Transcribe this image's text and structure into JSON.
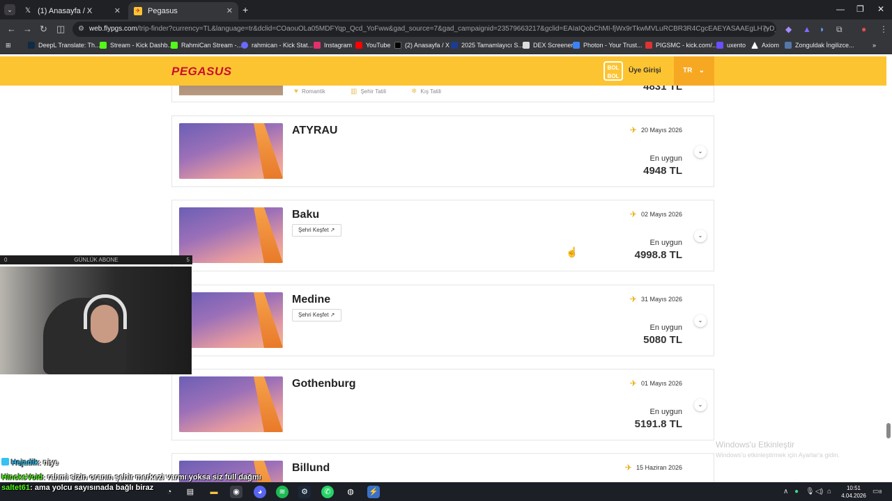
{
  "browser": {
    "tabs": [
      {
        "title": "(1) Anasayfa / X",
        "icon": "x-logo-icon"
      },
      {
        "title": "Pegasus",
        "icon": "pegasus-icon"
      }
    ],
    "url_domain": "web.flypgs.com",
    "url_path": "/trip-finder?currency=TL&language=tr&dclid=COaouOLa05MDFYqp_Qcd_YoFww&gad_source=7&gad_campaignid=23579663217&gclid=EAIaIQobChMI-fjWx9rTkwMVLuRCBR3R4CgcEAEYASAAEgLH7vD_BwE",
    "bookmarks": [
      {
        "label": "DeepL Translate: Th...",
        "color": "#0f2b46"
      },
      {
        "label": "Stream - Kick Dashb...",
        "color": "#53fc18"
      },
      {
        "label": "RahmiCan Stream -...",
        "color": "#53fc18"
      },
      {
        "label": "rahmican - Kick Stat...",
        "color": "#6a6aff"
      },
      {
        "label": "Instagram",
        "color": "#e1306c"
      },
      {
        "label": "YouTube",
        "color": "#ff0000"
      },
      {
        "label": "(2) Anasayfa / X",
        "color": "#000000"
      },
      {
        "label": "2025 Tamamlayıcı S...",
        "color": "#1a3d8f"
      },
      {
        "label": "DEX Screener",
        "color": "#dddddd"
      },
      {
        "label": "Photon - Your Trust...",
        "color": "#3b82f6"
      },
      {
        "label": "PIGSMC - kick.com/...",
        "color": "#d33"
      },
      {
        "label": "uxento",
        "color": "#6b4eff"
      },
      {
        "label": "Axiom",
        "color": "#ffffff"
      },
      {
        "label": "Zonguldak İngilizce...",
        "color": "#5577aa"
      }
    ]
  },
  "header": {
    "logo": "PEGASUS",
    "bolbol": "BOL BOL",
    "login": "Üye Girişi",
    "language": "TR"
  },
  "top_card": {
    "tags": [
      "Romantik",
      "Şehir Tatili",
      "Kış Tatili"
    ],
    "price": "4831 TL"
  },
  "destinations": [
    {
      "name": "ATYRAU",
      "date": "20 Mayıs 2026",
      "best_label": "En uygun",
      "price": "4948 TL",
      "explore": ""
    },
    {
      "name": "Baku",
      "date": "02 Mayıs 2026",
      "best_label": "En uygun",
      "price": "4998.8 TL",
      "explore": "Şehri Keşfet ↗"
    },
    {
      "name": "Medine",
      "date": "31 Mayıs 2026",
      "best_label": "En uygun",
      "price": "5080 TL",
      "explore": "Şehri Keşfet ↗"
    },
    {
      "name": "Gothenburg",
      "date": "01 Mayıs 2026",
      "best_label": "En uygun",
      "price": "5191.8 TL",
      "explore": ""
    },
    {
      "name": "Billund",
      "date": "15 Haziran 2026",
      "best_label": "",
      "price": "",
      "explore": ""
    }
  ],
  "watermark": {
    "title": "Windows'u Etkinleştir",
    "subtitle": "Windows'u etkinleştirmek için Ayarlar'a gidin."
  },
  "overlay": {
    "abone_left": "0",
    "abone_label": "GÜNLÜK ABONE",
    "abone_right": "5",
    "chat": [
      {
        "user": "Hejadik",
        "user_color": "#35c2f2",
        "message": ": niye"
      },
      {
        "user": "HincksVoid",
        "user_color": "#53fc18",
        "message": ": rahmi sizin oranın şehir merkezi varmı yoksa siz full dağmı"
      },
      {
        "user": "saltet61",
        "user_color": "#53fc18",
        "message": ": ama yolcu sayısınada bağlı biraz"
      }
    ]
  },
  "taskbar": {
    "time": "10:51",
    "date": "4.04.2026",
    "notifications": "8"
  }
}
